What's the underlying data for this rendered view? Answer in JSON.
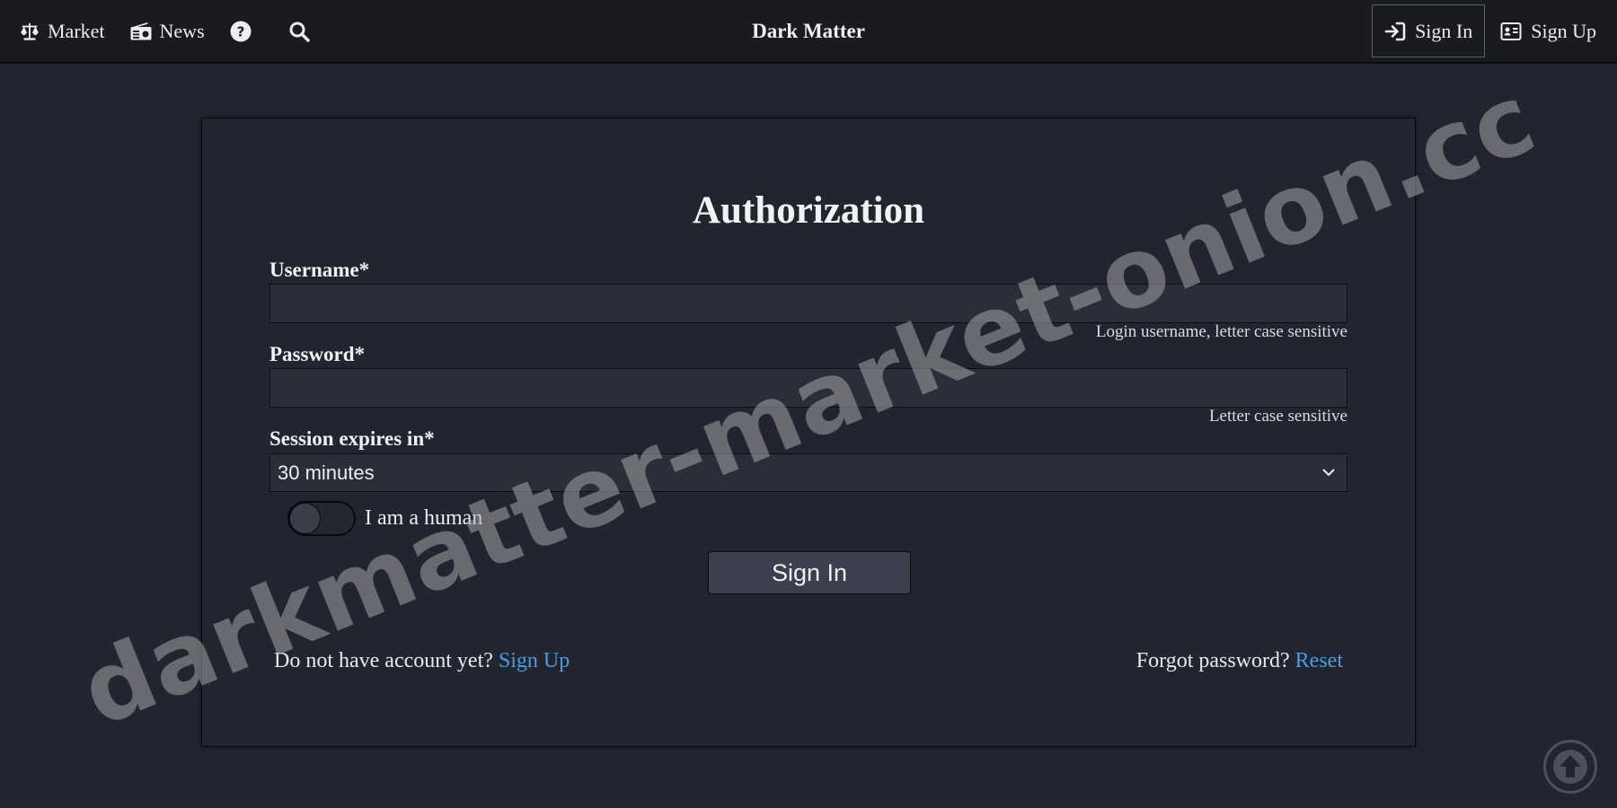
{
  "navbar": {
    "items": [
      {
        "label": "Market",
        "icon": "scale-icon"
      },
      {
        "label": "News",
        "icon": "radio-icon"
      }
    ],
    "help_icon": "question-circle-icon",
    "search_icon": "search-icon",
    "brand": "Dark Matter",
    "sign_in_label": "Sign In",
    "sign_up_label": "Sign Up"
  },
  "form": {
    "title": "Authorization",
    "username_label": "Username*",
    "username_value": "",
    "username_help": "Login username, letter case sensitive",
    "password_label": "Password*",
    "password_value": "",
    "password_help": "Letter case sensitive",
    "session_label": "Session expires in*",
    "session_value": "30 minutes",
    "human_label": "I am a human",
    "human_checked": false,
    "submit_label": "Sign In",
    "no_account_text": "Do not have account yet?",
    "sign_up_link": "Sign Up",
    "forgot_text": "Forgot password?",
    "reset_link": "Reset"
  },
  "watermark": "darkmatter-market-onion.cc",
  "scroll_top_icon": "arrow-up-circle-icon",
  "colors": {
    "background": "#222530",
    "navbar": "#191b21",
    "link": "#4b9be6",
    "input_bg": "#2b2e39",
    "button_bg": "#3b3f4e"
  }
}
